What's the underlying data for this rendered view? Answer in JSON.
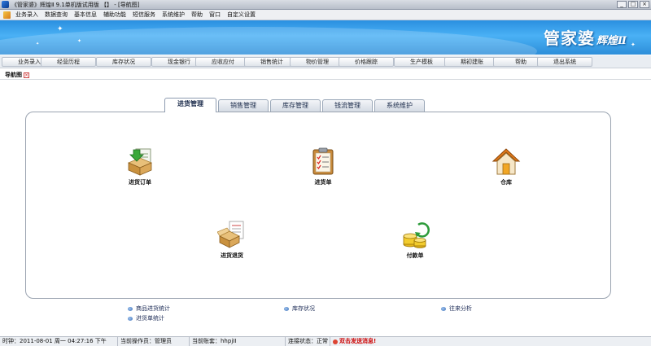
{
  "window": {
    "title": "《管家婆》辉煌Ⅱ 9.1单机版试用版 【】 - [导航图]",
    "controls": [
      "_",
      "□",
      "×"
    ]
  },
  "menu": {
    "items": [
      "业务录入",
      "数据查询",
      "基本信息",
      "辅助功能",
      "短信服务",
      "系统维护",
      "帮助",
      "窗口",
      "自定义设置"
    ]
  },
  "brand": {
    "main": "管家婆",
    "sub": "辉煌Ⅱ"
  },
  "nav": {
    "buttons": [
      "业务录入",
      "经营历程",
      "库存状况",
      "现金银行",
      "应收应付",
      "销售统计",
      "物价管理",
      "价格跟踪",
      "生产模板",
      "期初建账",
      "帮助",
      "退出系统"
    ]
  },
  "doc_tab": {
    "label": "导航图",
    "close": "×"
  },
  "tabs": {
    "items": [
      "进货管理",
      "销售管理",
      "库存管理",
      "钱流管理",
      "系统维护"
    ],
    "active": "进货管理"
  },
  "actions": {
    "purchase_order": "进货订单",
    "purchase_slip": "进货单",
    "warehouse": "仓库",
    "purchase_return": "进货退货",
    "payment_slip": "付款单"
  },
  "links": {
    "goods_stats": "商品进货统计",
    "stock_status": "库存状况",
    "ledger_analysis": "往来分析",
    "slip_stats": "进货单统计"
  },
  "status": {
    "time": "时钟：2011-08-01 周一 04:27:16 下午",
    "operator": "当前操作员：管理员",
    "account": "当前账套：hhpjII",
    "connection": "连接状态：正常",
    "message": "双击发送消息!"
  },
  "colors": {
    "banner": "#2d8ed9",
    "accent": "#d43"
  }
}
